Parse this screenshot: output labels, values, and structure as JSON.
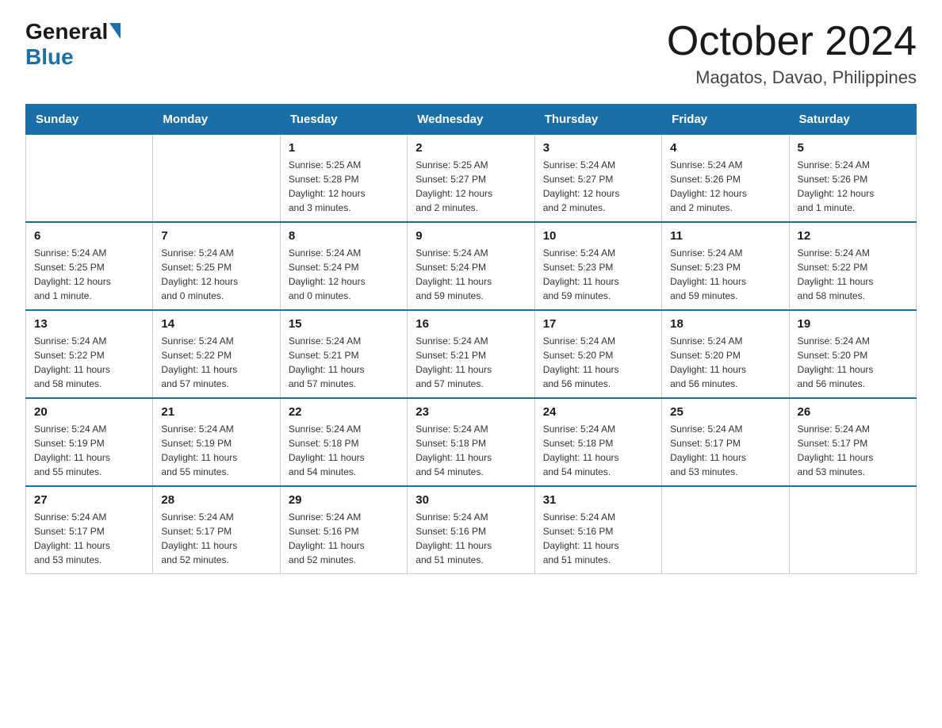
{
  "logo": {
    "general": "General",
    "blue": "Blue"
  },
  "title": "October 2024",
  "subtitle": "Magatos, Davao, Philippines",
  "days_of_week": [
    "Sunday",
    "Monday",
    "Tuesday",
    "Wednesday",
    "Thursday",
    "Friday",
    "Saturday"
  ],
  "weeks": [
    [
      {
        "day": "",
        "info": ""
      },
      {
        "day": "",
        "info": ""
      },
      {
        "day": "1",
        "info": "Sunrise: 5:25 AM\nSunset: 5:28 PM\nDaylight: 12 hours\nand 3 minutes."
      },
      {
        "day": "2",
        "info": "Sunrise: 5:25 AM\nSunset: 5:27 PM\nDaylight: 12 hours\nand 2 minutes."
      },
      {
        "day": "3",
        "info": "Sunrise: 5:24 AM\nSunset: 5:27 PM\nDaylight: 12 hours\nand 2 minutes."
      },
      {
        "day": "4",
        "info": "Sunrise: 5:24 AM\nSunset: 5:26 PM\nDaylight: 12 hours\nand 2 minutes."
      },
      {
        "day": "5",
        "info": "Sunrise: 5:24 AM\nSunset: 5:26 PM\nDaylight: 12 hours\nand 1 minute."
      }
    ],
    [
      {
        "day": "6",
        "info": "Sunrise: 5:24 AM\nSunset: 5:25 PM\nDaylight: 12 hours\nand 1 minute."
      },
      {
        "day": "7",
        "info": "Sunrise: 5:24 AM\nSunset: 5:25 PM\nDaylight: 12 hours\nand 0 minutes."
      },
      {
        "day": "8",
        "info": "Sunrise: 5:24 AM\nSunset: 5:24 PM\nDaylight: 12 hours\nand 0 minutes."
      },
      {
        "day": "9",
        "info": "Sunrise: 5:24 AM\nSunset: 5:24 PM\nDaylight: 11 hours\nand 59 minutes."
      },
      {
        "day": "10",
        "info": "Sunrise: 5:24 AM\nSunset: 5:23 PM\nDaylight: 11 hours\nand 59 minutes."
      },
      {
        "day": "11",
        "info": "Sunrise: 5:24 AM\nSunset: 5:23 PM\nDaylight: 11 hours\nand 59 minutes."
      },
      {
        "day": "12",
        "info": "Sunrise: 5:24 AM\nSunset: 5:22 PM\nDaylight: 11 hours\nand 58 minutes."
      }
    ],
    [
      {
        "day": "13",
        "info": "Sunrise: 5:24 AM\nSunset: 5:22 PM\nDaylight: 11 hours\nand 58 minutes."
      },
      {
        "day": "14",
        "info": "Sunrise: 5:24 AM\nSunset: 5:22 PM\nDaylight: 11 hours\nand 57 minutes."
      },
      {
        "day": "15",
        "info": "Sunrise: 5:24 AM\nSunset: 5:21 PM\nDaylight: 11 hours\nand 57 minutes."
      },
      {
        "day": "16",
        "info": "Sunrise: 5:24 AM\nSunset: 5:21 PM\nDaylight: 11 hours\nand 57 minutes."
      },
      {
        "day": "17",
        "info": "Sunrise: 5:24 AM\nSunset: 5:20 PM\nDaylight: 11 hours\nand 56 minutes."
      },
      {
        "day": "18",
        "info": "Sunrise: 5:24 AM\nSunset: 5:20 PM\nDaylight: 11 hours\nand 56 minutes."
      },
      {
        "day": "19",
        "info": "Sunrise: 5:24 AM\nSunset: 5:20 PM\nDaylight: 11 hours\nand 56 minutes."
      }
    ],
    [
      {
        "day": "20",
        "info": "Sunrise: 5:24 AM\nSunset: 5:19 PM\nDaylight: 11 hours\nand 55 minutes."
      },
      {
        "day": "21",
        "info": "Sunrise: 5:24 AM\nSunset: 5:19 PM\nDaylight: 11 hours\nand 55 minutes."
      },
      {
        "day": "22",
        "info": "Sunrise: 5:24 AM\nSunset: 5:18 PM\nDaylight: 11 hours\nand 54 minutes."
      },
      {
        "day": "23",
        "info": "Sunrise: 5:24 AM\nSunset: 5:18 PM\nDaylight: 11 hours\nand 54 minutes."
      },
      {
        "day": "24",
        "info": "Sunrise: 5:24 AM\nSunset: 5:18 PM\nDaylight: 11 hours\nand 54 minutes."
      },
      {
        "day": "25",
        "info": "Sunrise: 5:24 AM\nSunset: 5:17 PM\nDaylight: 11 hours\nand 53 minutes."
      },
      {
        "day": "26",
        "info": "Sunrise: 5:24 AM\nSunset: 5:17 PM\nDaylight: 11 hours\nand 53 minutes."
      }
    ],
    [
      {
        "day": "27",
        "info": "Sunrise: 5:24 AM\nSunset: 5:17 PM\nDaylight: 11 hours\nand 53 minutes."
      },
      {
        "day": "28",
        "info": "Sunrise: 5:24 AM\nSunset: 5:17 PM\nDaylight: 11 hours\nand 52 minutes."
      },
      {
        "day": "29",
        "info": "Sunrise: 5:24 AM\nSunset: 5:16 PM\nDaylight: 11 hours\nand 52 minutes."
      },
      {
        "day": "30",
        "info": "Sunrise: 5:24 AM\nSunset: 5:16 PM\nDaylight: 11 hours\nand 51 minutes."
      },
      {
        "day": "31",
        "info": "Sunrise: 5:24 AM\nSunset: 5:16 PM\nDaylight: 11 hours\nand 51 minutes."
      },
      {
        "day": "",
        "info": ""
      },
      {
        "day": "",
        "info": ""
      }
    ]
  ]
}
